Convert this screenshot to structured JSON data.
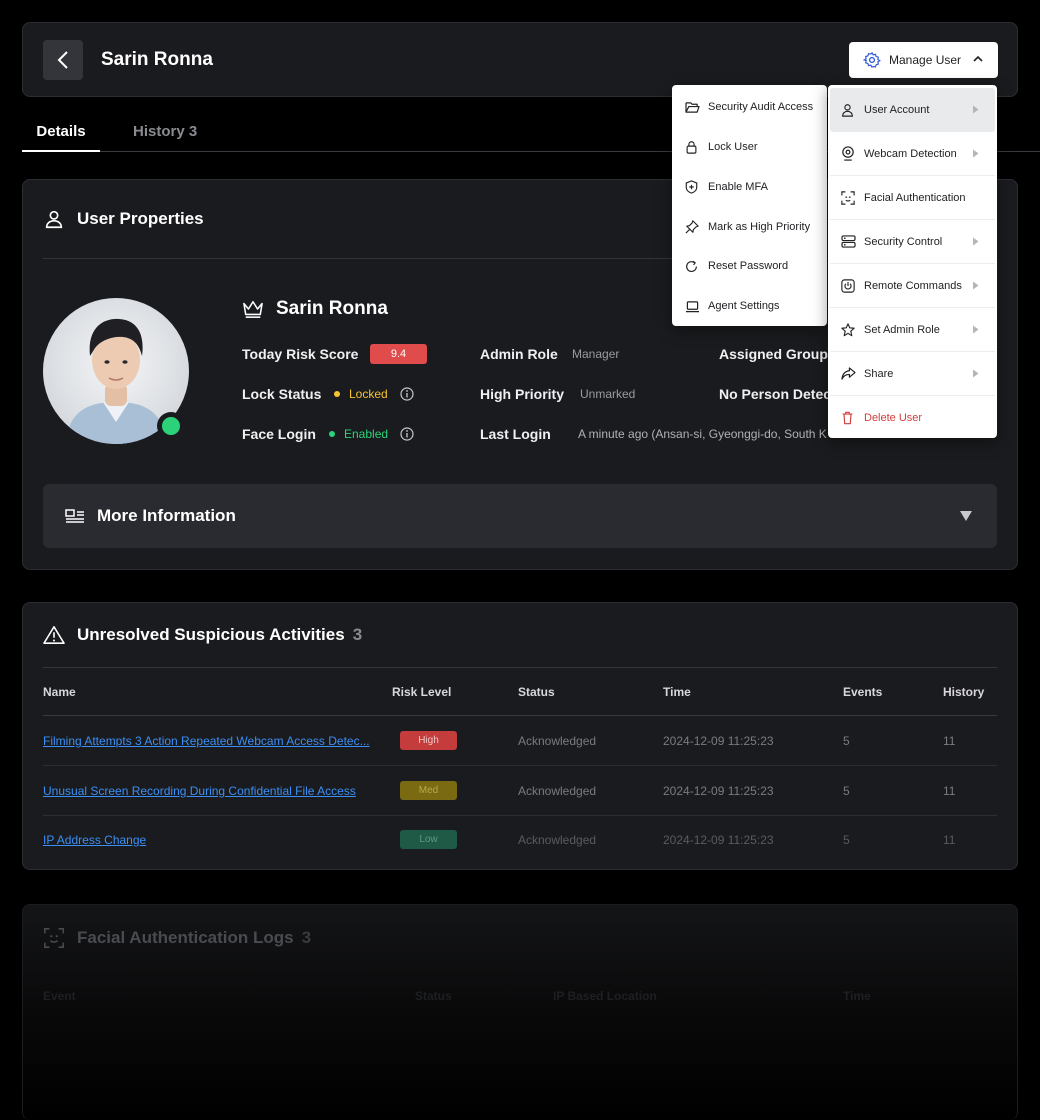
{
  "header": {
    "title": "Sarin Ronna",
    "manage_label": "Manage User"
  },
  "tabs": [
    {
      "label": "Details"
    },
    {
      "label": "History 3"
    }
  ],
  "user_properties": {
    "title": "User Properties",
    "name": "Sarin Ronna",
    "fields": {
      "risk_score_label": "Today Risk Score",
      "risk_score_value": "9.4",
      "lock_status_label": "Lock Status",
      "lock_status_value": "Locked",
      "face_login_label": "Face Login",
      "face_login_value": "Enabled",
      "admin_role_label": "Admin Role",
      "admin_role_value": "Manager",
      "high_priority_label": "High Priority",
      "high_priority_value": "Unmarked",
      "last_login_label": "Last Login",
      "last_login_value": "A minute ago (Ansan-si, Gyeonggi-do, South K",
      "assigned_group_label": "Assigned Group",
      "no_person_label": "No Person Detec"
    },
    "more_info": "More Information"
  },
  "suspicious": {
    "title": "Unresolved Suspicious Activities",
    "count": "3",
    "columns": [
      "Name",
      "Risk Level",
      "Status",
      "Time",
      "Events",
      "History"
    ],
    "rows": [
      {
        "name": "Filming Attempts 3 Action Repeated Webcam Access Detec...",
        "level": "High",
        "status": "Acknowledged",
        "time": "2024-12-09 11:25:23",
        "events": "5",
        "history": "11"
      },
      {
        "name": "Unusual Screen Recording During Confidential File Access",
        "level": "Med",
        "status": "Acknowledged",
        "time": "2024-12-09 11:25:23",
        "events": "5",
        "history": "11"
      },
      {
        "name": "IP Address Change",
        "level": "Low",
        "status": "Acknowledged",
        "time": "2024-12-09 11:25:23",
        "events": "5",
        "history": "11"
      }
    ]
  },
  "facial_logs": {
    "title": "Facial Authentication Logs",
    "count": "3",
    "columns": [
      "Event",
      "Status",
      "IP Based Location",
      "Time"
    ]
  },
  "menu_left": [
    {
      "label": "Security Audit Access",
      "icon": "folder-open-icon"
    },
    {
      "label": "Lock User",
      "icon": "lock-icon"
    },
    {
      "label": "Enable MFA",
      "icon": "shield-plus-icon"
    },
    {
      "label": "Mark as High Priority",
      "icon": "pin-icon"
    },
    {
      "label": "Reset Password",
      "icon": "refresh-icon"
    },
    {
      "label": "Agent Settings",
      "icon": "laptop-icon"
    }
  ],
  "menu_right": [
    {
      "label": "User Account",
      "icon": "user-icon"
    },
    {
      "label": "Webcam Detection",
      "icon": "webcam-icon"
    },
    {
      "label": "Facial Authentication",
      "icon": "face-scan-icon"
    },
    {
      "label": "Security Control",
      "icon": "server-icon"
    },
    {
      "label": "Remote Commands",
      "icon": "power-icon"
    },
    {
      "label": "Set Admin Role",
      "icon": "star-badge-icon"
    },
    {
      "label": "Share",
      "icon": "share-icon"
    },
    {
      "label": "Delete User",
      "icon": "trash-icon"
    }
  ],
  "colors": {
    "accent_link": "#3b8ff5",
    "risk_high": "#e04b4b",
    "locked": "#f5c431",
    "enabled": "#2bd27a",
    "danger": "#d23c3c"
  }
}
